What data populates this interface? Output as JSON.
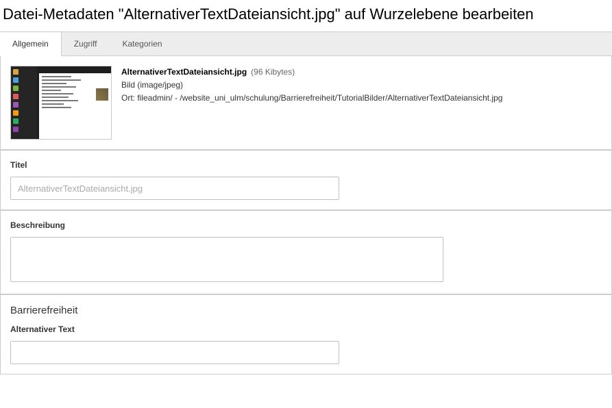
{
  "header": {
    "title": "Datei-Metadaten \"AlternativerTextDateiansicht.jpg\" auf Wurzelebene bearbeiten"
  },
  "tabs": [
    {
      "label": "Allgemein",
      "active": true
    },
    {
      "label": "Zugriff",
      "active": false
    },
    {
      "label": "Kategorien",
      "active": false
    }
  ],
  "file": {
    "name": "AlternativerTextDateiansicht.jpg",
    "size": "(96 Kibytes)",
    "type": "Bild (image/jpeg)",
    "location_label": "Ort:",
    "location_path": "fileadmin/ - /website_uni_ulm/schulung/Barrierefreiheit/TutorialBilder/AlternativerTextDateiansicht.jpg"
  },
  "fields": {
    "title": {
      "label": "Titel",
      "placeholder": "AlternativerTextDateiansicht.jpg",
      "value": ""
    },
    "description": {
      "label": "Beschreibung",
      "value": ""
    },
    "accessibility_heading": "Barrierefreiheit",
    "alt_text": {
      "label": "Alternativer Text",
      "value": ""
    }
  }
}
